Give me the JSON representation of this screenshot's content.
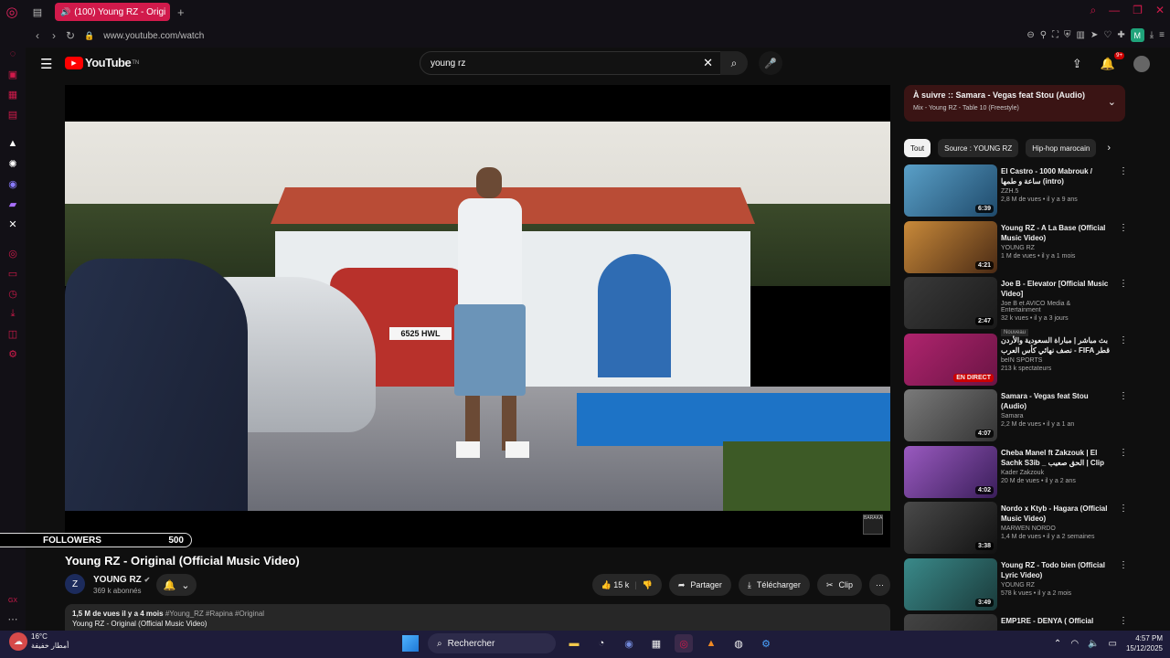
{
  "browser": {
    "tab_title": "(100) Young RZ - Origi",
    "url": "www.youtube.com/watch",
    "profile_initial": "M"
  },
  "youtube": {
    "logo_text": "YouTube",
    "logo_sup": "TN",
    "search_value": "young rz",
    "notifications_badge": "9+"
  },
  "video": {
    "plate_text": "6525 HWL",
    "watermark": "BARAKA",
    "title": "Young RZ - Original (Official Music Video)",
    "channel": "YOUNG RZ",
    "subscribers": "369 k abonnés",
    "likes": "15 k",
    "share_label": "Partager",
    "download_label": "Télécharger",
    "clip_label": "Clip",
    "desc_stats": "1,5 M de vues  il y a 4 mois",
    "desc_tags": "#Young_RZ #Rapina #Original",
    "desc_line2": "Young RZ - Original (Official Music Video)"
  },
  "overlay": {
    "followers_label": "FOLLOWERS",
    "followers_value": "500"
  },
  "up_next": {
    "title": "À suivre :: Samara - Vegas feat Stou (Audio)",
    "subtitle": "Mix - Young RZ - Table 10 (Freestyle)"
  },
  "chips": [
    "Tout",
    "Source : YOUNG RZ",
    "Hip-hop marocain"
  ],
  "recs": [
    {
      "title": "El Castro - 1000 Mabrouk / ساعة و طمها (intro)",
      "channel": "ZZH.5",
      "meta": "2,8 M de vues • il y a 9 ans",
      "duration": "6:39",
      "color1": "#5aa0c8",
      "color2": "#1f4a6b"
    },
    {
      "title": "Young RZ - A La Base (Official Music Video)",
      "channel": "YOUNG RZ",
      "meta": "1 M de vues • il y a 1 mois",
      "duration": "4:21",
      "color1": "#c98a3a",
      "color2": "#4a2a14"
    },
    {
      "title": "Joe B - Elevator [Official Music Video]",
      "channel": "Joe B et AVICO Media & Entertainment",
      "meta": "32 k vues • il y a 3 jours",
      "duration": "2:47",
      "badge": "Nouveau",
      "color1": "#3a3a3a",
      "color2": "#1a1a1a"
    },
    {
      "title": "بث مباشر | مباراة السعودية والأردن - نصف نهائي كأس العرب FIFA قطر",
      "channel": "beIN SPORTS",
      "meta": "213 k spectateurs",
      "duration": "EN DIRECT",
      "live": true,
      "color1": "#b0246e",
      "color2": "#6a1444"
    },
    {
      "title": "Samara - Vegas feat Stou (Audio)",
      "channel": "Samara",
      "meta": "2,2 M de vues • il y a 1 an",
      "duration": "4:07",
      "color1": "#7a7a7a",
      "color2": "#333333"
    },
    {
      "title": "Cheba Manel ft Zakzouk | El Sachk S3ib _ الحق صعيب | Clip ...",
      "channel": "Kader Zakzouk",
      "meta": "20 M de vues • il y a 2 ans",
      "duration": "4:02",
      "color1": "#9a5ac0",
      "color2": "#3a1e5a"
    },
    {
      "title": "Nordo x Ktyb - Hagara (Official Music Video)",
      "channel": "MARWEN NORDO",
      "meta": "1,4 M de vues • il y a 2 semaines",
      "duration": "3:38",
      "color1": "#4a4a4a",
      "color2": "#111111"
    },
    {
      "title": "Young RZ - Todo bien (Official Lyric Video)",
      "channel": "YOUNG RZ",
      "meta": "578 k vues • il y a 2 mois",
      "duration": "3:49",
      "color1": "#3a8a8a",
      "color2": "#1a3a3a"
    },
    {
      "title": "EMP1RE - DENYA ( Official",
      "channel": "",
      "meta": "",
      "duration": "",
      "color1": "#444444",
      "color2": "#222222"
    }
  ],
  "taskbar": {
    "temperature": "16°C",
    "weather_desc": "أمطار خفيفة",
    "search_label": "Rechercher",
    "time": "4:57 PM",
    "date": "15/12/2025"
  }
}
